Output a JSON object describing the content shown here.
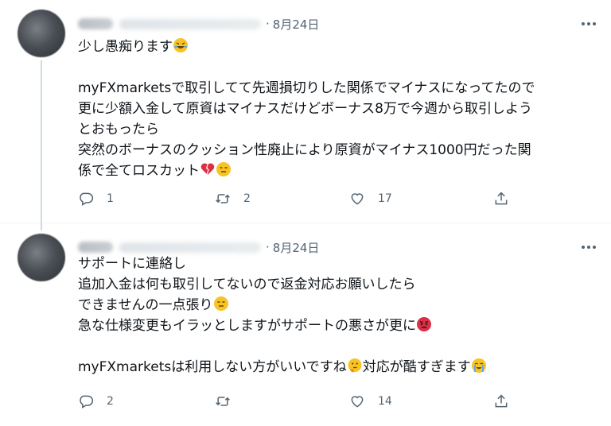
{
  "tweets": [
    {
      "date": "8月24日",
      "separator": "·",
      "lines": [
        "少し愚痴ります",
        "",
        "myFXmarketsで取引してて先週損切りした関係でマイナスになってたので",
        "更に少額入金して原資はマイナスだけどボーナス8万で今週から取引しよう",
        "とおもったら",
        "突然のボーナスのクッション性廃止により原資がマイナス1000円だった関",
        "係で全てロスカット"
      ],
      "replies": "1",
      "retweets": "2",
      "likes": "17"
    },
    {
      "date": "8月24日",
      "separator": "·",
      "lines": [
        "サポートに連絡し",
        "追加入金は何も取引してないので返金対応お願いしたら",
        "できませんの一点張り",
        "急な仕様変更もイラッとしますがサポートの悪さが更に",
        "",
        "myFXmarketsは利用しない方がいいですね",
        "対応が酷すぎます"
      ],
      "replies": "2",
      "retweets": "",
      "likes": "14"
    }
  ],
  "icons": {
    "reply": "reply-icon",
    "retweet": "retweet-icon",
    "like": "heart-icon",
    "share": "share-icon",
    "more": "more-icon"
  },
  "colors": {
    "text": "#0f1419",
    "secondary": "#536471",
    "divider": "#eff3f4",
    "thread": "#cfd9de"
  }
}
